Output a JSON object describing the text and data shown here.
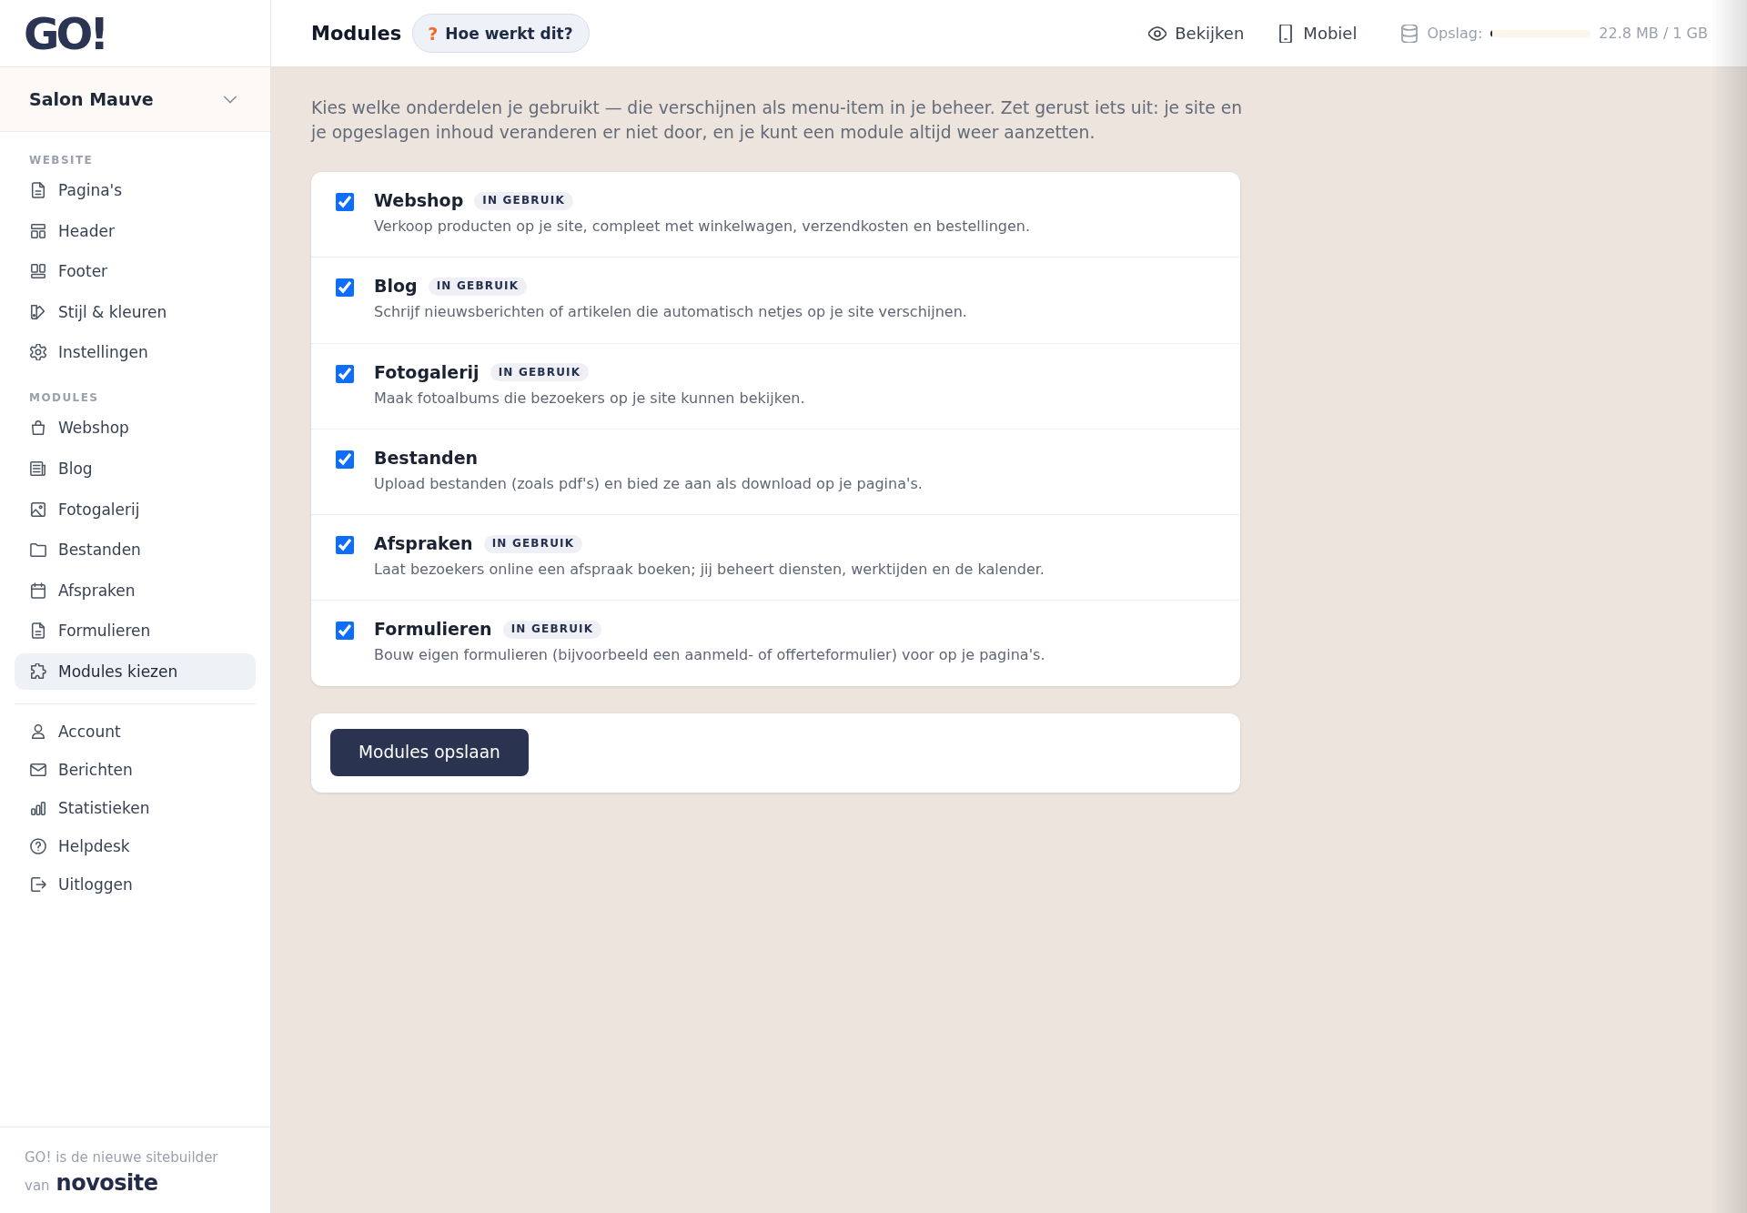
{
  "logo": {
    "text": "GO!"
  },
  "site_selector": {
    "name": "Salon Mauve"
  },
  "sidebar": {
    "sections": [
      {
        "heading": "WEBSITE",
        "items": [
          {
            "label": "Pagina's",
            "selected": false
          },
          {
            "label": "Header",
            "selected": false
          },
          {
            "label": "Footer",
            "selected": false
          },
          {
            "label": "Stijl & kleuren",
            "selected": false
          },
          {
            "label": "Instellingen",
            "selected": false
          }
        ]
      },
      {
        "heading": "MODULES",
        "items": [
          {
            "label": "Webshop",
            "selected": false
          },
          {
            "label": "Blog",
            "selected": false
          },
          {
            "label": "Fotogalerij",
            "selected": false
          },
          {
            "label": "Bestanden",
            "selected": false
          },
          {
            "label": "Afspraken",
            "selected": false
          },
          {
            "label": "Formulieren",
            "selected": false
          },
          {
            "label": "Modules kiezen",
            "selected": true
          }
        ]
      },
      {
        "items": [
          {
            "label": "Account",
            "selected": false
          },
          {
            "label": "Berichten",
            "selected": false
          },
          {
            "label": "Statistieken",
            "selected": false
          },
          {
            "label": "Helpdesk",
            "selected": false
          },
          {
            "label": "Uitloggen",
            "selected": false
          }
        ]
      }
    ]
  },
  "sidebar_footer": {
    "text": "GO! is de nieuwe sitebuilder",
    "prefix": "van",
    "brand": "novosite"
  },
  "header": {
    "title": "Modules",
    "help_button": {
      "icon": "?",
      "label": "Hoe werkt dit?"
    },
    "actions": [
      {
        "label": "Bekijken"
      },
      {
        "label": "Mobiel"
      }
    ],
    "storage": {
      "label": "Opslag:",
      "level": 0.02,
      "reading": "22.8 MB / 1 GB"
    }
  },
  "intro": "Kies welke onderdelen je gebruikt — die verschijnen als menu-item in je beheer. Zet gerust iets uit: je site en je opgeslagen inhoud veranderen er niet door, en je kunt een module altijd weer aanzetten.",
  "modules": [
    {
      "name": "Webshop",
      "badge": "IN GEBRUIK",
      "description": "Verkoop producten op je site, compleet met winkelwagen, verzendkosten en bestellingen.",
      "checked": true
    },
    {
      "name": "Blog",
      "badge": "IN GEBRUIK",
      "description": "Schrijf nieuwsberichten of artikelen die automatisch netjes op je site verschijnen.",
      "checked": true
    },
    {
      "name": "Fotogalerij",
      "badge": "IN GEBRUIK",
      "description": "Maak fotoalbums die bezoekers op je site kunnen bekijken.",
      "checked": true
    },
    {
      "name": "Bestanden",
      "description": "Upload bestanden (zoals pdf's) en bied ze aan als download op je pagina's.",
      "checked": true
    },
    {
      "name": "Afspraken",
      "badge": "IN GEBRUIK",
      "description": "Laat bezoekers online een afspraak boeken; jij beheert diensten, werktijden en de kalender.",
      "checked": true
    },
    {
      "name": "Formulieren",
      "badge": "IN GEBRUIK",
      "description": "Bouw eigen formulieren (bijvoorbeeld een aanmeld- of offerteformulier) voor op je pagina's.",
      "checked": true
    }
  ],
  "save_button": {
    "label": "Modules opslaan"
  }
}
